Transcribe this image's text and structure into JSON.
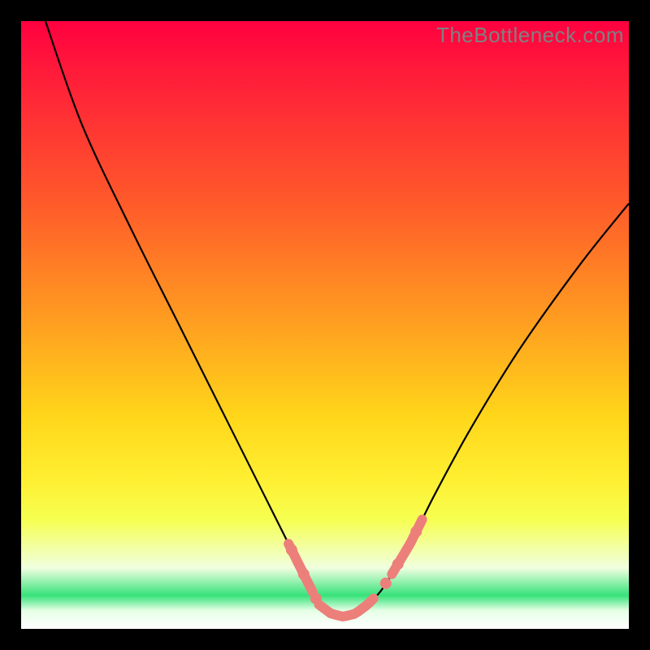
{
  "watermark": "TheBottleneck.com",
  "chart_data": {
    "type": "line",
    "title": "",
    "xlabel": "",
    "ylabel": "",
    "xlim": [
      0,
      100
    ],
    "ylim": [
      0,
      100
    ],
    "series": [
      {
        "name": "bottleneck-curve",
        "x": [
          4,
          10,
          18,
          26,
          34,
          40,
          44,
          47,
          49,
          51,
          53,
          55,
          57,
          59,
          61,
          64,
          68,
          74,
          82,
          92,
          100
        ],
        "y": [
          100,
          83,
          66,
          50,
          34,
          22,
          14,
          8,
          4,
          2.5,
          2,
          2.5,
          4,
          6,
          9,
          14,
          22,
          33,
          46,
          60,
          70
        ]
      }
    ],
    "annotations": {
      "pink_highlight_segments": [
        {
          "from_x": 44,
          "to_x": 48
        },
        {
          "from_x": 49,
          "to_x": 58
        },
        {
          "from_x": 61,
          "to_x": 66
        }
      ],
      "pink_dots_x": [
        44.5,
        46.5,
        48.5,
        60,
        62,
        65
      ]
    },
    "gradient_stops": [
      {
        "pct": 0,
        "color": "#ff0040"
      },
      {
        "pct": 30,
        "color": "#ff5a2a"
      },
      {
        "pct": 65,
        "color": "#ffd61a"
      },
      {
        "pct": 82,
        "color": "#f6ff50"
      },
      {
        "pct": 94,
        "color": "#37e27a"
      },
      {
        "pct": 100,
        "color": "#ffffff"
      }
    ]
  }
}
